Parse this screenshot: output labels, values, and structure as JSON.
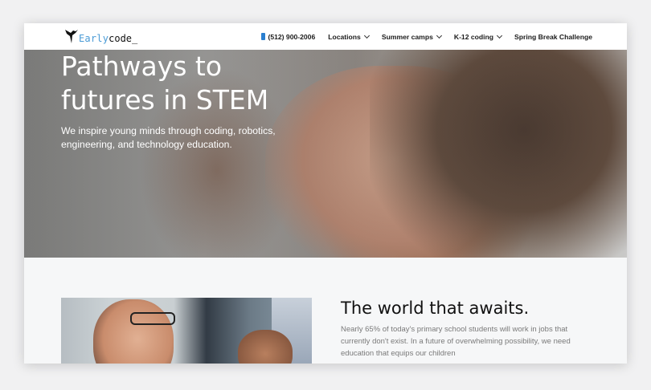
{
  "nav": {
    "logo_early": "Early",
    "logo_code": "code_",
    "phone": "(512) 900-2006",
    "items": [
      {
        "label": "Locations",
        "has_dropdown": true
      },
      {
        "label": "Summer camps",
        "has_dropdown": true
      },
      {
        "label": "K-12 coding",
        "has_dropdown": true
      },
      {
        "label": "Spring Break Challenge",
        "has_dropdown": false
      }
    ]
  },
  "hero": {
    "title": "Pathways to futures in STEM",
    "subtitle": "We inspire young minds through coding, robotics, engineering, and technology education."
  },
  "section": {
    "heading": "The world that awaits.",
    "body": "Nearly 65% of today's primary school students will work in jobs that currently don't exist. In a future of overwhelming possibility, we need education that equips our children"
  },
  "colors": {
    "logo_blue": "#4a9bd6",
    "phone_icon": "#2a7fd0"
  },
  "icons": {
    "logo": "hummingbird-icon",
    "phone": "mobile-phone-icon",
    "dropdown": "chevron-down-icon"
  }
}
